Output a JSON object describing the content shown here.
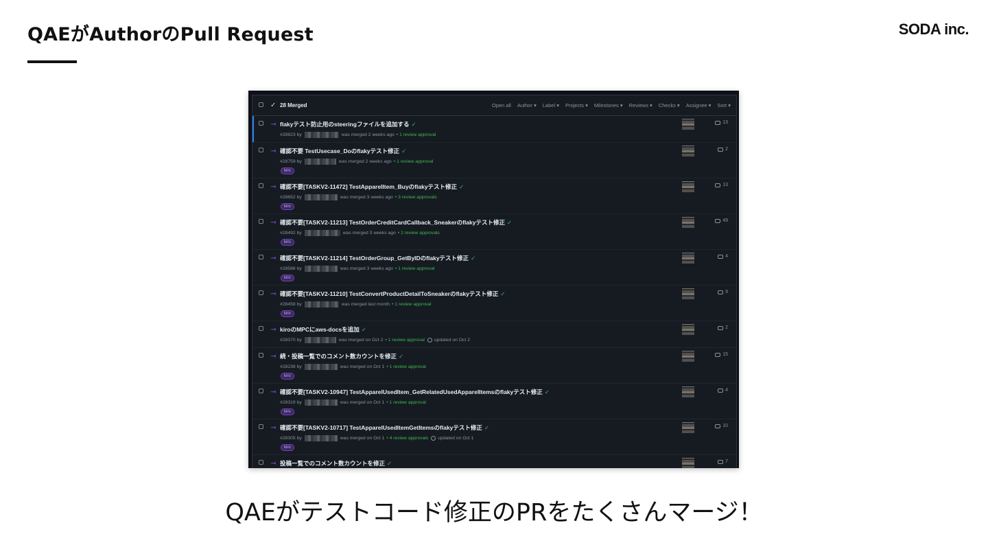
{
  "slide": {
    "title": "QAEがAuthorのPull Request",
    "logo": "SODA inc.",
    "caption": "QAEがテストコード修正のPRをたくさんマージ！"
  },
  "screenshot": {
    "header": {
      "merged": "28 Merged",
      "filters": [
        "Open all",
        "Author ▾",
        "Label ▾",
        "Projects ▾",
        "Milestones ▾",
        "Reviews ▾",
        "Checks ▾",
        "Assignee ▾",
        "Sort ▾"
      ]
    },
    "rows": [
      {
        "title": "flakyテスト防止用のsteeringファイルを追加する",
        "number": "#28823 by",
        "merged": "was merged 2 weeks ago",
        "approvals": "• 1 review approval",
        "updated": "",
        "label": "",
        "comments": "13"
      },
      {
        "title": "確認不要 TestUsecase_Doのflakyテスト修正",
        "number": "#28759 by",
        "merged": "was merged 2 weeks ago",
        "approvals": "• 1 review approval",
        "updated": "",
        "label": "kiro",
        "comments": "2"
      },
      {
        "title": "確認不要[TASKV2-11472] TestApparelItem_Buyのflakyテスト修正",
        "number": "#28652 by",
        "merged": "was merged 3 weeks ago",
        "approvals": "• 3 review approvals",
        "updated": "",
        "label": "kiro",
        "comments": "13"
      },
      {
        "title": "確認不要[TASKV2-11213] TestOrderCreditCardCallback_Sneakerのflakyテスト修正",
        "number": "#28492 by",
        "merged": "was merged 3 weeks ago",
        "approvals": "• 2 review approvals",
        "updated": "",
        "label": "kiro",
        "comments": "49"
      },
      {
        "title": "確認不要[TASKV2-11214] TestOrderGroup_GetByIDのflakyテスト修正",
        "number": "#28588 by",
        "merged": "was merged 3 weeks ago",
        "approvals": "• 1 review approval",
        "updated": "",
        "label": "kiro",
        "comments": "4"
      },
      {
        "title": "確認不要[TASKV2-11210] TestConvertProductDetailToSneakerのflakyテスト修正",
        "number": "#28458 by",
        "merged": "was merged last month",
        "approvals": "• 1 review approval",
        "updated": "",
        "label": "kiro",
        "comments": "9"
      },
      {
        "title": "kiroのMPCにaws-docsを追加",
        "number": "#28370 by",
        "merged": "was merged on Oct 2",
        "approvals": "• 1 review approval",
        "updated": "updated on Oct 2",
        "label": "",
        "comments": "2"
      },
      {
        "title": "続・投稿一覧でのコメント数カウントを修正",
        "number": "#28238 by",
        "merged": "was merged on Oct 1",
        "approvals": "• 1 review approval",
        "updated": "",
        "label": "kiro",
        "comments": "15"
      },
      {
        "title": "確認不要[TASKV2-10947] TestApparelUsedItem_GetRelatedUsedApparelItemsのflakyテスト修正",
        "number": "#28319 by",
        "merged": "was merged on Oct 1",
        "approvals": "• 1 review approval",
        "updated": "",
        "label": "kiro",
        "comments": "4"
      },
      {
        "title": "確認不要[TASKV2-10717] TestApparelUsedItemGetItemsのflakyテスト修正",
        "number": "#28305 by",
        "merged": "was merged on Oct 1",
        "approvals": "• 4 review approvals",
        "updated": "updated on Oct 1",
        "label": "kiro",
        "comments": "10"
      },
      {
        "title": "投稿一覧でのコメント数カウントを修正",
        "number": "",
        "merged": "",
        "approvals": "",
        "updated": "",
        "label": "",
        "comments": "7"
      }
    ]
  }
}
